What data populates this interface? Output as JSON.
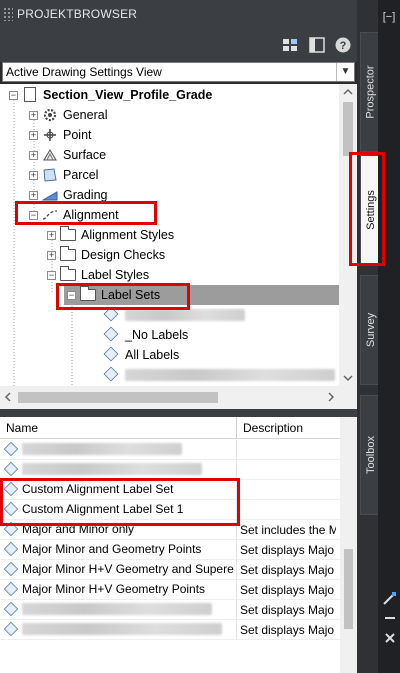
{
  "panel": {
    "title": "PROJEKTBROWSER",
    "close_glyph": "[−]"
  },
  "toolbar": {
    "icons": [
      "grid-view-icon",
      "panel-view-icon",
      "help-icon"
    ],
    "help_glyph": "?"
  },
  "view_select": {
    "value": "Active Drawing Settings View"
  },
  "tree": {
    "root": "Section_View_Profile_Grade",
    "items": [
      {
        "label": "General"
      },
      {
        "label": "Point"
      },
      {
        "label": "Surface"
      },
      {
        "label": "Parcel"
      },
      {
        "label": "Grading"
      },
      {
        "label": "Alignment"
      },
      {
        "label": "Alignment Styles"
      },
      {
        "label": "Design Checks"
      },
      {
        "label": "Label Styles"
      },
      {
        "label": "Label Sets"
      },
      {
        "label": "_No Labels"
      },
      {
        "label": "All Labels"
      }
    ]
  },
  "list": {
    "columns": [
      "Name",
      "Description"
    ],
    "rows": [
      {
        "name": "",
        "description": ""
      },
      {
        "name": "",
        "description": ""
      },
      {
        "name": "Custom Alignment Label Set",
        "description": ""
      },
      {
        "name": "Custom Alignment Label Set 1",
        "description": ""
      },
      {
        "name": "Major and Minor only",
        "description": "Set includes the M"
      },
      {
        "name": "Major Minor and Geometry Points",
        "description": "Set displays Majo"
      },
      {
        "name": "Major Minor H+V Geometry and Supere",
        "description": "Set displays Majo"
      },
      {
        "name": "Major Minor H+V Geometry Points",
        "description": "Set displays Majo"
      },
      {
        "name": "",
        "description": "Set displays Majo"
      },
      {
        "name": "",
        "description": "Set displays Majo"
      }
    ]
  },
  "side_tabs": [
    {
      "label": "Prospector",
      "active": false
    },
    {
      "label": "Settings",
      "active": true
    },
    {
      "label": "Survey",
      "active": false
    },
    {
      "label": "Toolbox",
      "active": false
    }
  ],
  "colors": {
    "highlight": "#e10000",
    "selection": "#9c9c9c",
    "panel": "#3b3e42"
  }
}
